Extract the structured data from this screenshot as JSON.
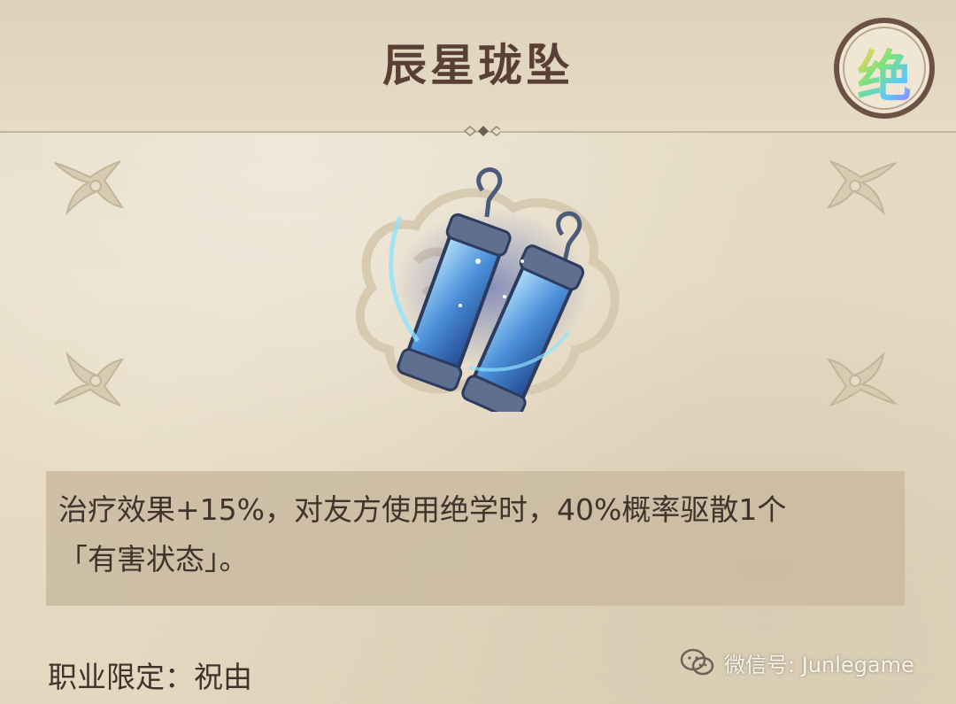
{
  "item": {
    "name": "辰星珑坠",
    "rarity_badge": "绝",
    "description_line1": "治疗效果+15%，对友方使用绝学时，40%概率驱散1个",
    "description_line2": "「有害状态」。",
    "restriction": "职业限定：祝由"
  },
  "watermark": {
    "text": "微信号: Junlegame",
    "icon": "wechat-icon"
  },
  "icons": {
    "item_art": "earring-pendant-icon",
    "corners": "floral-corner-ornament-icon"
  },
  "colors": {
    "background": "#e7dcc6",
    "title": "#5a3f34",
    "text": "#3f342c",
    "description_box": "#c9baa0"
  }
}
